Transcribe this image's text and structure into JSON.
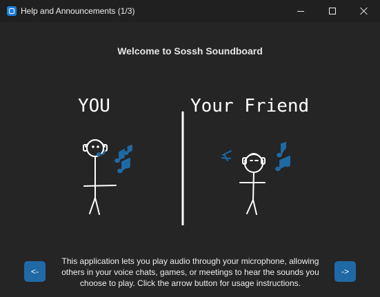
{
  "window": {
    "title": "Help and Announcements (1/3)",
    "icon": "app-icon"
  },
  "page": {
    "heading": "Welcome to Sossh Soundboard",
    "illustration": {
      "left_label": "YOU",
      "right_label": "Your Friend",
      "accent_color": "#1f6aa5"
    },
    "description": "This application lets you play audio through your microphone, allowing others in your voice chats, games, or meetings to hear the sounds you choose to play. Click the arrow button for usage instructions.",
    "prev_label": "<-",
    "next_label": "->"
  }
}
